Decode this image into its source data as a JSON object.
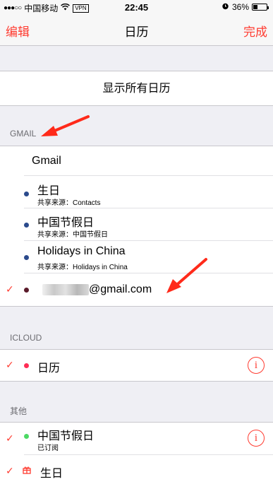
{
  "status_bar": {
    "signal": "●●●○○",
    "carrier": "中国移动",
    "wifi_icon": "wifi-icon",
    "vpn": "VPN",
    "time": "22:45",
    "alarm_icon": "alarm-icon",
    "battery": "36%"
  },
  "nav": {
    "edit": "编辑",
    "title": "日历",
    "done": "完成"
  },
  "show_all": "显示所有日历",
  "gmail": {
    "header": "GMAIL",
    "account": "Gmail",
    "items": [
      {
        "label": "生日",
        "sub": "共享来源：Contacts",
        "dot_color": "#2b4a8c"
      },
      {
        "label": "中国节假日",
        "sub": "共享来源：中国节假日",
        "dot_color": "#2b4a8c"
      },
      {
        "label": "Holidays in China",
        "sub": "共享来源：Holidays in China",
        "dot_color": "#2b4a8c"
      },
      {
        "label": "@gmail.com",
        "checked": true,
        "dot_color": "#5a1a2a"
      }
    ]
  },
  "icloud": {
    "header": "ICLOUD",
    "items": [
      {
        "label": "日历",
        "checked": true,
        "dot_color": "#ff2d55"
      }
    ]
  },
  "other": {
    "header": "其他",
    "items": [
      {
        "label": "中国节假日",
        "sub": "已订阅",
        "checked": true,
        "dot_color": "#4cd964"
      },
      {
        "label": "生日",
        "checked": true,
        "icon": "gift-icon",
        "icon_color": "#ff3b30"
      }
    ]
  },
  "colors": {
    "accent": "#ff3b30",
    "background": "#efeff4",
    "annotation_arrow": "#ff2a1a"
  }
}
